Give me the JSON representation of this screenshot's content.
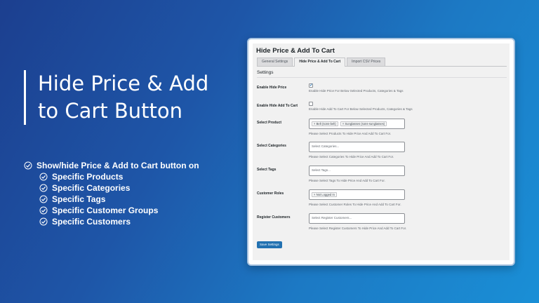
{
  "hero": {
    "title": "Hide Price & Add to Cart Button"
  },
  "features": {
    "main": "Show/hide Price & Add to Cart button on",
    "items": [
      "Specific Products",
      "Specific Categories",
      "Specific Tags",
      "Specific Customer Groups",
      "Specific Customers"
    ]
  },
  "panel": {
    "title": "Hide Price & Add To Cart",
    "tabs": [
      "General Settings",
      "Hide Price & Add To Cart",
      "Import CSV Prices"
    ],
    "active_tab": 1,
    "section_title": "Settings",
    "enable_hide_price": {
      "label": "Enable Hide Price",
      "checked": "✓",
      "help": "Enable Hide Price For Below Selected Products, Categories & Tags"
    },
    "enable_hide_cart": {
      "label": "Enable Hide Add To Cart",
      "checked": "",
      "help": "Enable Hide Add To Cart For Below Selected Products, Categories & Tags"
    },
    "select_product": {
      "label": "Select Product",
      "chips": [
        "× Belt (sons-belt)",
        "× Sunglasses (sons-sunglasses)"
      ],
      "help": "Please Select Products To Hide Price And Add To Cart For."
    },
    "select_categories": {
      "label": "Select Categories",
      "placeholder": "Select Categories...",
      "help": "Please Select Categories To Hide Price And Add To Cart For."
    },
    "select_tags": {
      "label": "Select Tags",
      "placeholder": "Select Tags...",
      "help": "Please Select Tags To Hide Price And Add To Cart For."
    },
    "customer_roles": {
      "label": "Customer Roles",
      "chips": [
        "× Not Logged In"
      ],
      "help": "Please Select Customer Roles To Hide Price And Add To Cart For."
    },
    "register_customers": {
      "label": "Register Customers",
      "placeholder": "Select Register Customers...",
      "help": "Please Select Register Customers To Hide Price And Add To Cart For."
    },
    "save_label": "Save Settings"
  },
  "colors": {
    "accent": "#2271b1",
    "background_start": "#1c3f8f",
    "background_end": "#1a8fd6"
  }
}
